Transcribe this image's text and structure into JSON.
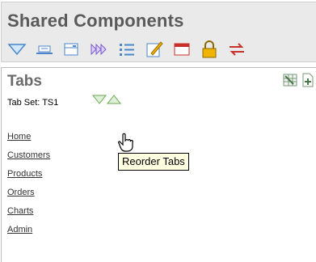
{
  "shared_components": {
    "title": "Shared Components",
    "icons": [
      "lists-of-values-icon",
      "breadcrumbs-icon",
      "navigation-bar-icon",
      "trees-icon",
      "lists-icon",
      "templates-icon",
      "themes-icon",
      "security-icon",
      "globalization-icon"
    ]
  },
  "tabs": {
    "title": "Tabs",
    "tab_set_label": "Tab Set: TS1",
    "items": [
      "Home",
      "Customers",
      "Products",
      "Orders",
      "Charts",
      "Admin"
    ],
    "tooltip": "Reorder Tabs"
  }
}
